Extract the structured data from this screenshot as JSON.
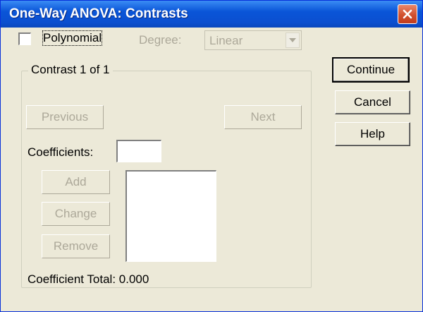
{
  "window": {
    "title": "One-Way ANOVA: Contrasts"
  },
  "polynomial": {
    "label": "Polynomial",
    "checked": false
  },
  "degree": {
    "label": "Degree:",
    "value": "Linear"
  },
  "contrast": {
    "group_label": "Contrast 1 of 1",
    "previous_label": "Previous",
    "next_label": "Next",
    "coefficients_label": "Coefficients:",
    "coefficients_value": "",
    "add_label": "Add",
    "change_label": "Change",
    "remove_label": "Remove",
    "coefficient_total_label": "Coefficient Total:",
    "coefficient_total_value": "0.000"
  },
  "buttons": {
    "continue_label": "Continue",
    "cancel_label": "Cancel",
    "help_label": "Help"
  },
  "icons": {
    "close": "close-icon",
    "dropdown": "chevron-down-icon"
  },
  "colors": {
    "titlebar": "#0a55d8",
    "close": "#d1502e",
    "face": "#ece9d8",
    "disabled_text": "#aca899"
  }
}
